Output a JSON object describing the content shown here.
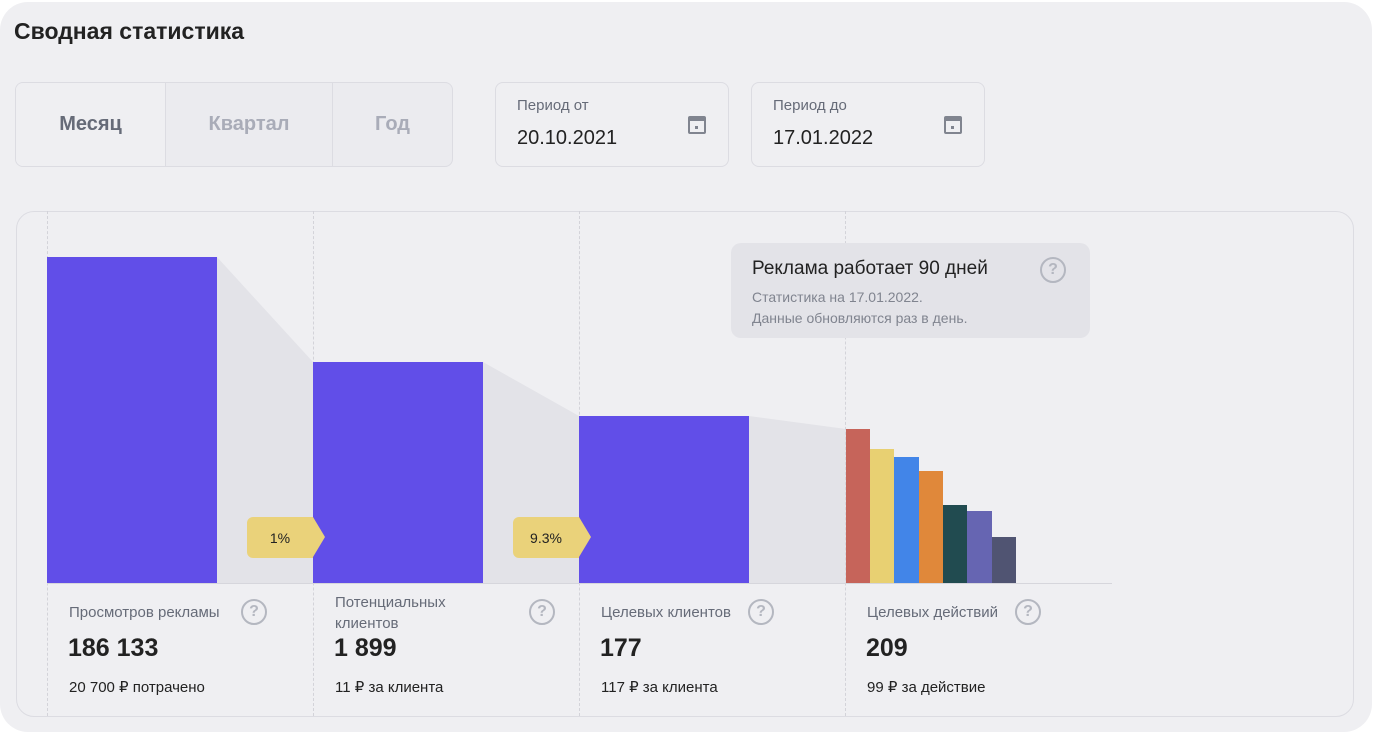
{
  "title": "Сводная статистика",
  "period_tabs": [
    {
      "label": "Месяц",
      "active": true
    },
    {
      "label": "Квартал",
      "active": false
    },
    {
      "label": "Год",
      "active": false
    }
  ],
  "date_from": {
    "label": "Период от",
    "value": "20.10.2021",
    "icon": "calendar-icon"
  },
  "date_to": {
    "label": "Период до",
    "value": "17.01.2022",
    "icon": "calendar-icon"
  },
  "info": {
    "heading": "Реклама работает 90 дней",
    "line1": "Статистика на 17.01.2022.",
    "line2": "Данные обновляются раз в день."
  },
  "conversions": [
    "1%",
    "9.3%"
  ],
  "colors": {
    "funnel_bar": "#614ee8",
    "badge": "#ead27a",
    "action_bars": [
      "#c6645a",
      "#e8d072",
      "#4285e8",
      "#e0883a",
      "#214b50",
      "#6665b2",
      "#505472"
    ]
  },
  "stats": [
    {
      "label": "Просмотров рекламы",
      "value": "186 133",
      "sub": "20 700 ₽ потрачено"
    },
    {
      "label": "Потенциальных клиентов",
      "value": "1 899",
      "sub": "11 ₽ за клиента"
    },
    {
      "label": "Целевых клиентов",
      "value": "177",
      "sub": "117 ₽ за клиента"
    },
    {
      "label": "Целевых действий",
      "value": "209",
      "sub": "99 ₽ за действие"
    }
  ]
}
